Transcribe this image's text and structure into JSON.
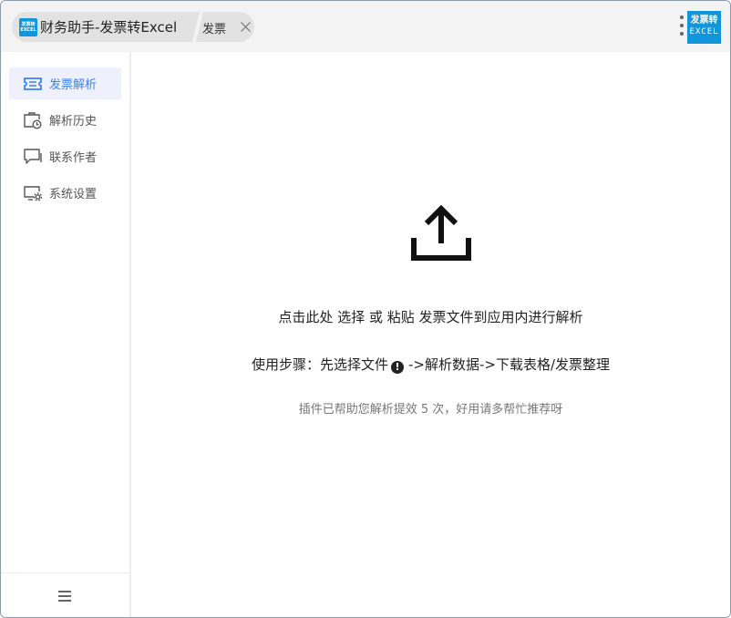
{
  "header": {
    "app_tab_label": "财务助手-发票转Excel",
    "doc_tab_label": "发票",
    "logo_text_top": "发票转",
    "logo_text_bottom": "EXCEL",
    "brand_badge_top": "发票转",
    "brand_badge_bottom": "EXCEL",
    "accent_color": "#1296db"
  },
  "sidebar": {
    "items": [
      {
        "label": "发票解析",
        "icon": "ticket-icon",
        "active": true
      },
      {
        "label": "解析历史",
        "icon": "history-icon",
        "active": false
      },
      {
        "label": "联系作者",
        "icon": "message-icon",
        "active": false
      },
      {
        "label": "系统设置",
        "icon": "settings-monitor-icon",
        "active": false
      }
    ],
    "active_color": "#3b82f6",
    "menu_icon": "hamburger-icon"
  },
  "main": {
    "upload_icon": "upload-icon",
    "drop_prefix": "点击此处 ",
    "drop_select": "选择",
    "drop_or": " 或 ",
    "drop_paste": "粘贴",
    "drop_suffix": " 发票文件到应用内进行解析",
    "steps_prefix": "使用步骤：先选择文件",
    "steps_info_glyph": "!",
    "steps_suffix": "->解析数据->下载表格/发票整理",
    "note": "插件已帮助您解析提效 5 次，好用请多帮忙推荐呀"
  }
}
